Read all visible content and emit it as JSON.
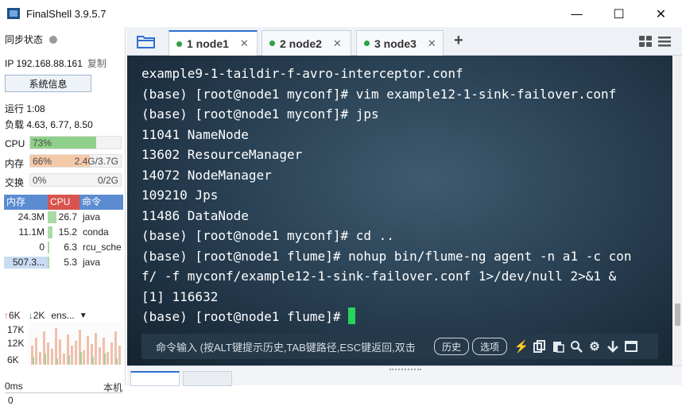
{
  "window": {
    "title": "FinalShell 3.9.5.7",
    "controls": {
      "minimize": "—",
      "maximize": "☐",
      "close": "✕"
    }
  },
  "sidebar": {
    "sync_status": "同步状态",
    "ip_label": "IP 192.168.88.161",
    "copy_label": "复制",
    "sysinfo_button": "系统信息",
    "uptime": "运行 1:08",
    "load": "负载 4.63, 6.77, 8.50",
    "cpu": {
      "label": "CPU",
      "percent_text": "73%",
      "percent": 73,
      "color": "#8fd18a"
    },
    "memory": {
      "label": "内存",
      "percent_text": "66%",
      "percent": 66,
      "detail": "2.4G/3.7G",
      "color": "#f4c9a8"
    },
    "swap": {
      "label": "交换",
      "percent_text": "0%",
      "percent": 0,
      "detail": "0/2G"
    },
    "process_table": {
      "headers": {
        "mem": "内存",
        "cpu": "CPU",
        "cmd": "命令"
      },
      "rows": [
        {
          "mem": "24.3M",
          "cpu": "26.7",
          "cmd": "java",
          "cpu_level": 0.27
        },
        {
          "mem": "11.1M",
          "cpu": "15.2",
          "cmd": "conda",
          "cpu_level": 0.15
        },
        {
          "mem": "0",
          "cpu": "6.3",
          "cmd": "rcu_sche",
          "cpu_level": 0.06
        },
        {
          "mem": "507.3...",
          "cpu": "5.3",
          "cmd": "java",
          "cpu_level": 0.05
        }
      ]
    },
    "network": {
      "up": "6K",
      "down": "2K",
      "interface": "ens...",
      "y_labels": [
        "17K",
        "12K",
        "6K"
      ]
    },
    "latency": {
      "value": "0ms",
      "right": "本机",
      "bottom": "0"
    }
  },
  "tabs": [
    {
      "label": "1 node1",
      "active": true
    },
    {
      "label": "2 node2",
      "active": false
    },
    {
      "label": "3 node3",
      "active": false
    }
  ],
  "terminal": {
    "lines": [
      "example9-1-taildir-f-avro-interceptor.conf",
      "(base) [root@node1 myconf]# vim example12-1-sink-failover.conf",
      "(base) [root@node1 myconf]# jps",
      "11041 NameNode",
      "13602 ResourceManager",
      "14072 NodeManager",
      "109210 Jps",
      "11486 DataNode",
      "(base) [root@node1 myconf]# cd ..",
      "(base) [root@node1 flume]# nohup bin/flume-ng agent -n a1 -c con",
      "f/ -f myconf/example12-1-sink-failover.conf 1>/dev/null 2>&1 &",
      "[1] 116632",
      "(base) [root@node1 flume]# "
    ]
  },
  "command_bar": {
    "placeholder": "命令输入 (按ALT键提示历史,TAB键路径,ESC键返回,双击",
    "history_button": "历史",
    "options_button": "选项"
  }
}
